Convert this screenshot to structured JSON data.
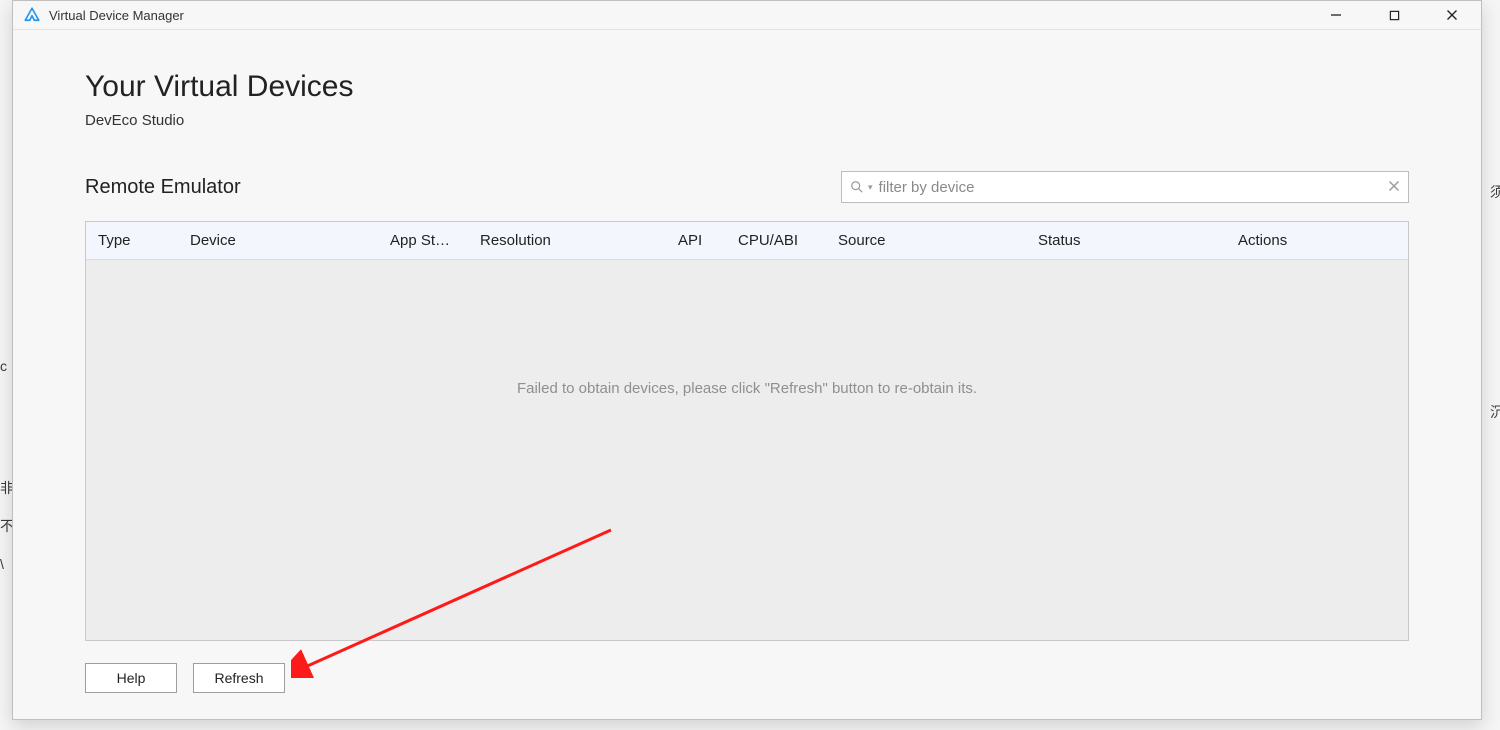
{
  "window": {
    "title": "Virtual Device Manager"
  },
  "page": {
    "title": "Your Virtual Devices",
    "subtitle": "DevEco Studio"
  },
  "section": {
    "title": "Remote Emulator"
  },
  "filter": {
    "placeholder": "filter by device",
    "value": ""
  },
  "table": {
    "columns": {
      "type": "Type",
      "device": "Device",
      "appsto": "App Sto…",
      "res": "Resolution",
      "api": "API",
      "cpu": "CPU/ABI",
      "source": "Source",
      "status": "Status",
      "actions": "Actions"
    },
    "rows": [],
    "empty_message": "Failed to obtain devices, please click \"Refresh\" button to re-obtain its."
  },
  "footer": {
    "help_label": "Help",
    "refresh_label": "Refresh"
  }
}
